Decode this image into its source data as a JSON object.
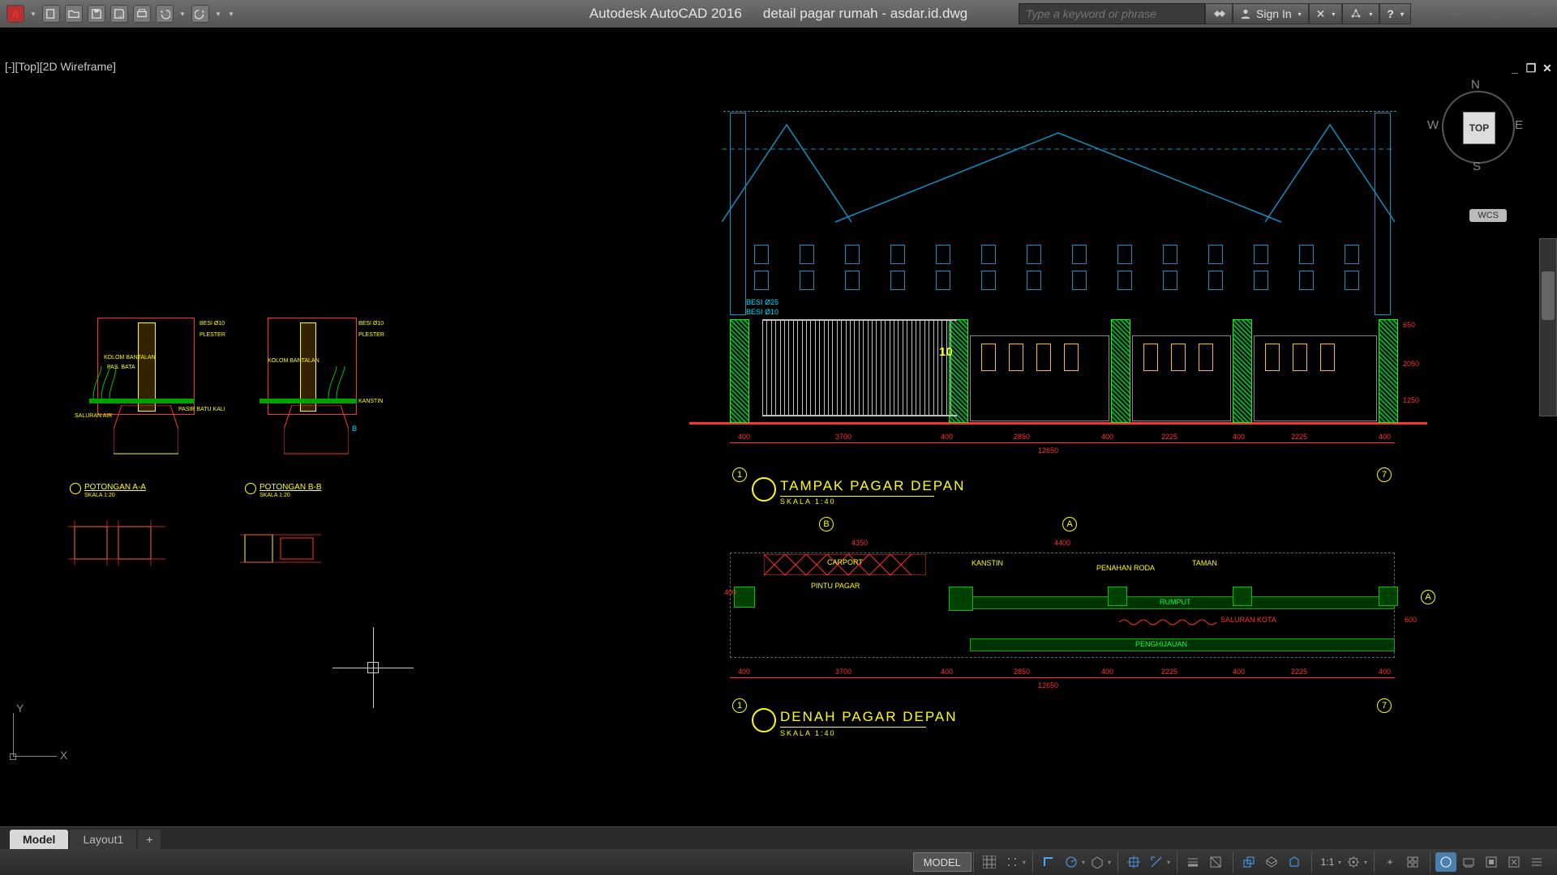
{
  "app": {
    "name": "Autodesk AutoCAD 2016",
    "file": "detail pagar rumah - asdar.id.dwg"
  },
  "viewport_label": "[-][Top][2D Wireframe]",
  "search_placeholder": "Type a keyword or phrase",
  "sign_in": "Sign In",
  "viewcube": {
    "face": "TOP",
    "n": "N",
    "s": "S",
    "e": "E",
    "w": "W"
  },
  "wcs": "WCS",
  "tabs": {
    "model": "Model",
    "layout1": "Layout1"
  },
  "status": {
    "model": "MODEL",
    "scale": "1:1"
  },
  "drawing": {
    "elev_title": "TAMPAK PAGAR DEPAN",
    "elev_scale": "SKALA 1:40",
    "plan_title": "DENAH PAGAR DEPAN",
    "plan_scale": "SKALA 1:40",
    "rebar1": "BESI Ø25",
    "rebar2": "BESI Ø10",
    "gate_no": "10",
    "dims_top": [
      "400",
      "3700",
      "400",
      "2850",
      "400",
      "2225",
      "400",
      "2225",
      "400"
    ],
    "dim_total": "12650",
    "dims_plan": [
      "400",
      "3700",
      "400",
      "2850",
      "400",
      "2225",
      "400",
      "2225",
      "400"
    ],
    "dim_plan_total": "12650",
    "dim_side": [
      "650",
      "2050",
      "1250"
    ],
    "dim_plan_side": [
      "400",
      "600"
    ],
    "dim_carport": "4350",
    "dim_plan_right": "4400",
    "bubbles": {
      "left": "1",
      "right": "7",
      "a": "A",
      "b": "B"
    },
    "plan_labels": {
      "carport": "CARPORT",
      "pintu": "PINTU PAGAR",
      "kanstin": "KANSTIN",
      "penahan": "PENAHAN RODA",
      "taman": "TAMAN",
      "rumput": "RUMPUT",
      "saluran": "SALURAN KOTA",
      "penghijauan": "PENGHIJAUAN"
    },
    "sections": {
      "aa_title": "POTONGAN A-A",
      "aa_scale": "SKALA 1:20",
      "bb_title": "POTONGAN B-B",
      "bb_scale": "SKALA 1:20",
      "lbl_besi": "BESI Ø10",
      "lbl_plester": "PLESTER",
      "lbl_kolom": "KOLOM BANTALAN",
      "lbl_bata": "PAS. BATA",
      "lbl_saluran": "SALURAN AIR",
      "lbl_batu": "PASIR BATU KALI",
      "lbl_kanstin": "KANSTIN"
    }
  }
}
